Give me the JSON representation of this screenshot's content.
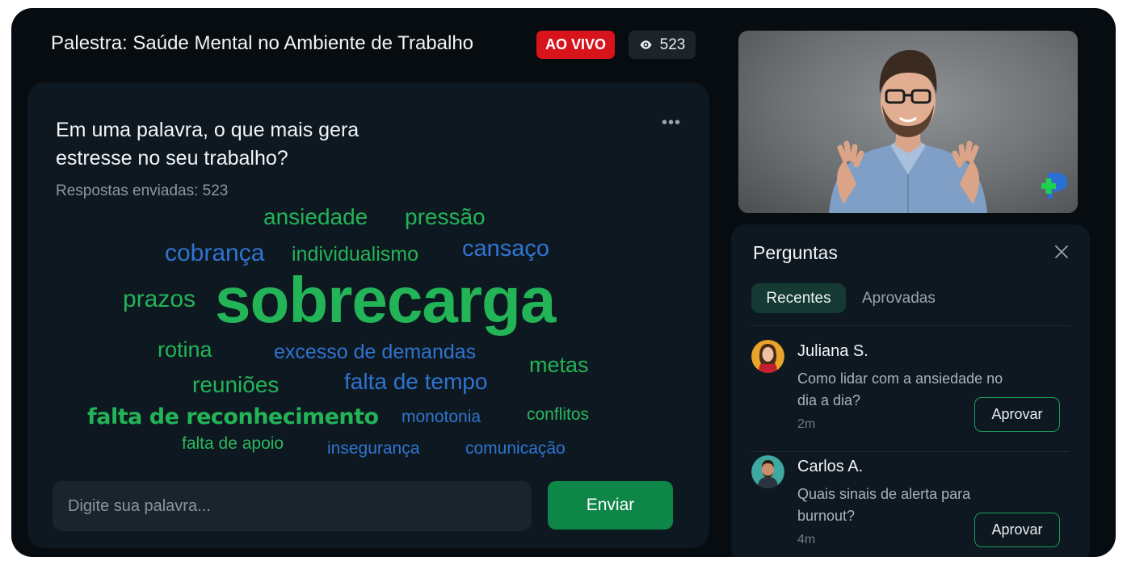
{
  "header": {
    "title": "Palestra: Saúde Mental no Ambiente de Trabalho",
    "live_label": "AO VIVO",
    "viewer_count": "523",
    "viewer_icon": "eye-icon"
  },
  "poll": {
    "question": "Em uma palavra, o que mais gera estresse no seu trabalho?",
    "responses_label": "Respostas enviadas: 523",
    "more_icon": "more-horizontal-icon",
    "words": [
      "ansiedade",
      "pressão",
      "cobrança",
      "individualismo",
      "cansaço",
      "prazos",
      "sobrecarga",
      "rotina",
      "excesso de demandas",
      "metas",
      "reuniões",
      "falta de tempo",
      "falta de reconhecimento",
      "monotonia",
      "conflitos",
      "falta de apoio",
      "insegurança",
      "comunicação"
    ],
    "input_placeholder": "Digite sua palavra...",
    "input_value": "",
    "send_label": "Enviar"
  },
  "colors": {
    "accent_green": "#22b457",
    "accent_blue": "#2f74d0",
    "live_red": "#d7141c",
    "button_green": "#0d8647",
    "background": "#070c11"
  },
  "questions_panel": {
    "title": "Perguntas",
    "close_icon": "close-icon",
    "tabs": [
      {
        "label": "Recentes",
        "active": true
      },
      {
        "label": "Aprovadas",
        "active": false
      }
    ],
    "items": [
      {
        "name": "Juliana S.",
        "text": "Como lidar com a ansiedade no dia a dia?",
        "time": "2m",
        "action": "Aprovar"
      },
      {
        "name": "Carlos A.",
        "text": "Quais sinais de alerta para burnout?",
        "time": "4m",
        "action": "Aprovar"
      }
    ]
  }
}
